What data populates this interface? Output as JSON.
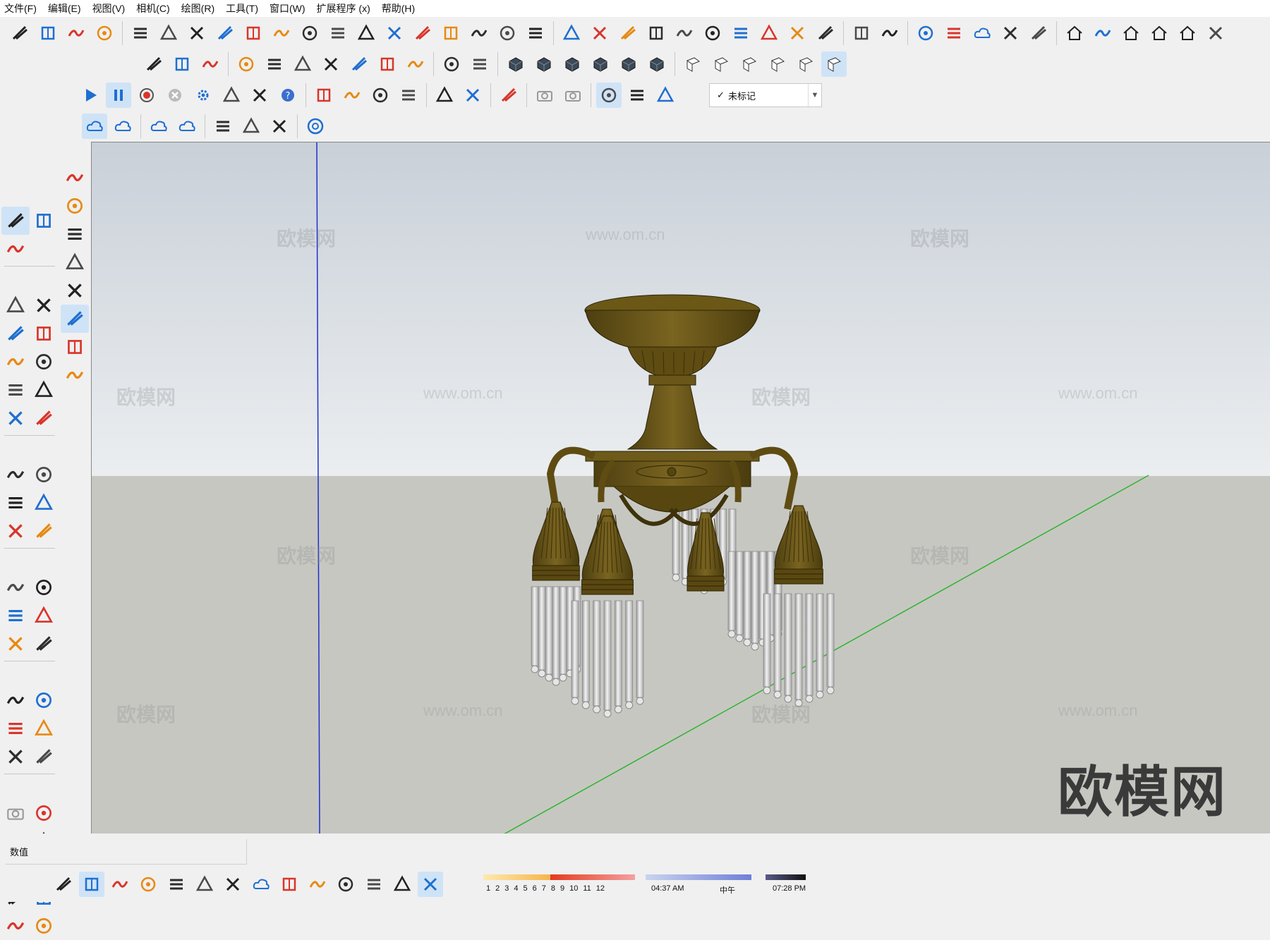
{
  "menu": [
    "文件(F)",
    "编辑(E)",
    "视图(V)",
    "相机(C)",
    "绘图(R)",
    "工具(T)",
    "窗口(W)",
    "扩展程序 (x)",
    "帮助(H)"
  ],
  "tag_select": {
    "value": "未标记",
    "checked": true
  },
  "status": {
    "measurements_label": "数值"
  },
  "shadow": {
    "months": [
      "1",
      "2",
      "3",
      "4",
      "5",
      "6",
      "7",
      "8",
      "9",
      "10",
      "11",
      "12"
    ],
    "time_start": "04:37 AM",
    "noon": "中午",
    "time_end": "07:28 PM"
  },
  "viewport": {
    "brand": "欧模网",
    "watermark_cn": "欧模网",
    "watermark_url": "www.om.cn"
  },
  "colors": {
    "sky_top": "#c9d0d8",
    "sky_bottom": "#ebeef0",
    "ground": "#c7c7c2",
    "bronze": "#6e5a1a",
    "crystal": "#d4d4d4",
    "axis_blue": "#1e2fd0",
    "axis_green": "#2fb52f"
  },
  "icons": {
    "row1": [
      "stairs-icon",
      "door-frame-icon",
      "ramp-icon",
      "bar-chart-icon",
      "sections-icon",
      "align-icon",
      "path-icon",
      "hub-icon",
      "arch-icon",
      "curve-icon",
      "knot-icon",
      "slab-icon",
      "pipe-icon",
      "layers-icon",
      "layers-alt-icon",
      "building-icon",
      "flip-icon",
      "arc-handle-icon",
      "chain-icon",
      "wave-icon",
      "spiral-icon",
      "solar-icon",
      "wall-icon",
      "columns-icon",
      "mirror-icon",
      "grid-dots-icon",
      "pillar-icon",
      "pen-icon",
      "broom-icon",
      "component-a-icon",
      "component-b-icon",
      "folder-up-icon",
      "checkbox-icon",
      "cloud-up-icon",
      "box-export-icon",
      "blue-logo-icon",
      "home-3d-icon",
      "wardrobe-icon",
      "house-icon",
      "roof-icon",
      "house-outline-icon",
      "cabinet-icon"
    ],
    "row2": [
      "knife-icon",
      "dimension-icon",
      "sweep-icon",
      "wedge-icon",
      "box-icon",
      "cylinder-icon",
      "fold-icon",
      "extrude-icon",
      "cross-icon",
      "snake-icon",
      "sel-a-icon",
      "sel-b-icon",
      "solid-a-icon",
      "solid-b-icon",
      "solid-c-icon",
      "solid-d-icon",
      "solid-e-icon",
      "solid-f-icon",
      "face-a-icon",
      "face-b-icon",
      "face-c-icon",
      "face-d-icon",
      "face-e-icon",
      "face-f-icon"
    ],
    "row3": [
      "play-icon",
      "pause-icon",
      "record-icon",
      "stop-icon",
      "gear-icon",
      "film-icon",
      "film-dim-icon",
      "help-icon",
      "dot-icon",
      "cone-icon",
      "line-icon",
      "square-icon",
      "hidden-icon",
      "plugin-icon",
      "rotate-dim-icon",
      "camera-video-icon",
      "camera-icon",
      "tag-cycle-icon",
      "flower-icon",
      "cube-outline-icon"
    ],
    "row4": [
      "cloud-wave-icon",
      "cloud-share-icon",
      "cloud-check-icon",
      "cloud-list-icon",
      "frame-icon",
      "molecule-icon",
      "refresh-check-icon",
      "chrome-icon"
    ]
  }
}
